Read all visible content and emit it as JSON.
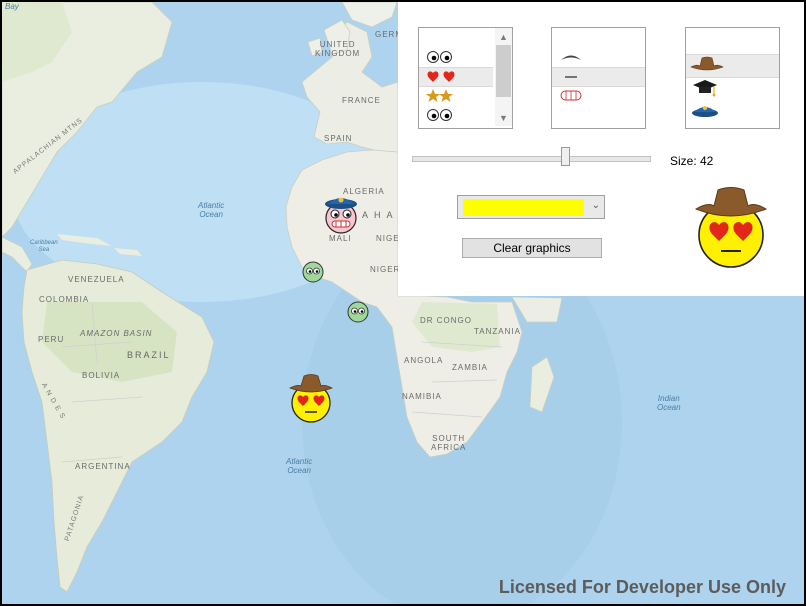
{
  "map": {
    "labels": {
      "united_kingdom": "UNITED\nKINGDOM",
      "germany": "GERM",
      "france": "FRANCE",
      "spain": "SPAIN",
      "algeria": "ALGERIA",
      "mali": "MALI",
      "niger": "NIGER",
      "nigeria": "NIGERIA",
      "sahara": "A H A",
      "dr_congo": "DR CONGO",
      "tanzania": "TANZANIA",
      "angola": "ANGOLA",
      "zambia": "ZAMBIA",
      "namibia": "NAMIBIA",
      "south_africa": "SOUTH\nAFRICA",
      "venezuela": "VENEZUELA",
      "colombia": "COLOMBIA",
      "amazon_basin": "AMAZON BASIN",
      "peru": "PERU",
      "brazil": "BRAZIL",
      "bolivia": "BOLIVIA",
      "andes": "A N D E S",
      "argentina": "ARGENTINA",
      "patagonia": "PATAGONIA",
      "appalachian": "APPALACHIAN MTNS",
      "bay": "Bay",
      "atlantic_north": "Atlantic\nOcean",
      "atlantic_south": "Atlantic\nOcean",
      "indian": "Indian\nOcean",
      "caribbean": "Caribbean\nSea"
    }
  },
  "panel": {
    "eyes_list": {
      "items": [
        "googly-eyes",
        "heart-eyes",
        "star-eyes",
        "googly-eyes"
      ],
      "selected_index": 1
    },
    "mouth_list": {
      "items": [
        "eyebrow",
        "flat-mouth",
        "grin-teeth"
      ],
      "selected_index": 1
    },
    "hat_list": {
      "items": [
        "cowboy-hat",
        "graduation-cap",
        "police-cap"
      ],
      "selected_index": 0
    },
    "size_label": "Size: 42",
    "size_value": 42,
    "selected_color": "#ffff00",
    "clear_button": "Clear graphics"
  },
  "preview": {
    "face": "yellow",
    "eyes": "heart-eyes",
    "mouth": "flat-mouth",
    "hat": "cowboy-hat"
  },
  "graphics": [
    {
      "face": "pink",
      "eyes": "googly-eyes",
      "mouth": "grin-teeth",
      "hat": "police-cap"
    },
    {
      "face": "green",
      "eyes": "googly-eyes",
      "mouth": "none",
      "hat": "none"
    },
    {
      "face": "green",
      "eyes": "googly-eyes",
      "mouth": "none",
      "hat": "none"
    },
    {
      "face": "yellow",
      "eyes": "heart-eyes",
      "mouth": "flat-mouth",
      "hat": "cowboy-hat"
    }
  ],
  "watermark": "Licensed For Developer Use Only"
}
